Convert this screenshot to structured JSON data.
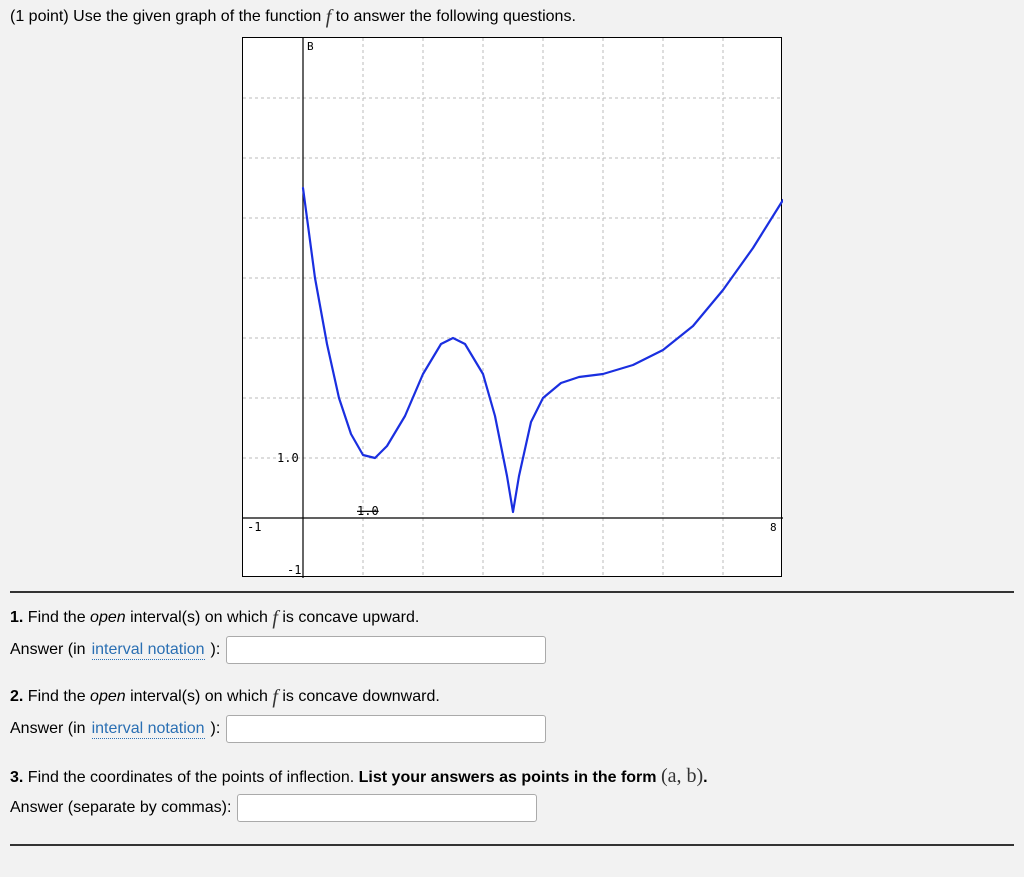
{
  "prompt": {
    "points_prefix": "(1 point) ",
    "text_before_f": "Use the given graph of the function ",
    "f": "f",
    "text_after_f": " to answer the following questions."
  },
  "graph": {
    "x_axis_min_label": "-1",
    "x_axis_max_label": "8",
    "y_axis_top_label": "B",
    "y_axis_bottom_label": "-1",
    "y_tick_label": "1.0",
    "x_tick_label": "1.0"
  },
  "q1": {
    "num": "1.",
    "before_em": " Find the ",
    "em": "open",
    "mid": " interval(s) on which ",
    "f": "f",
    "after": " is concave upward.",
    "answer_prefix": "Answer (in ",
    "link": "interval notation",
    "answer_suffix": "):"
  },
  "q2": {
    "num": "2.",
    "before_em": " Find the ",
    "em": "open",
    "mid": " interval(s) on which ",
    "f": "f",
    "after": " is concave downward.",
    "answer_prefix": "Answer (in ",
    "link": "interval notation",
    "answer_suffix": "):"
  },
  "q3": {
    "num": "3.",
    "text": " Find the coordinates of the points of inflection. ",
    "bold": "List your answers as points in the form ",
    "math": "(a, b)",
    "bold_end": ".",
    "answer_text": "Answer (separate by commas):"
  },
  "chart_data": {
    "type": "line",
    "xlabel": "",
    "ylabel": "",
    "xlim": [
      -1,
      8
    ],
    "ylim": [
      -1,
      8
    ],
    "y_gridlines": [
      1,
      2,
      3,
      4,
      5,
      6,
      7
    ],
    "x_gridlines": [
      1,
      2,
      3,
      4,
      5,
      6,
      7
    ],
    "series": [
      {
        "name": "f",
        "points": [
          [
            0.0,
            5.5
          ],
          [
            0.2,
            4.0
          ],
          [
            0.4,
            2.9
          ],
          [
            0.6,
            2.0
          ],
          [
            0.8,
            1.4
          ],
          [
            1.0,
            1.05
          ],
          [
            1.2,
            1.0
          ],
          [
            1.4,
            1.2
          ],
          [
            1.7,
            1.7
          ],
          [
            2.0,
            2.4
          ],
          [
            2.3,
            2.9
          ],
          [
            2.5,
            3.0
          ],
          [
            2.7,
            2.9
          ],
          [
            3.0,
            2.4
          ],
          [
            3.2,
            1.7
          ],
          [
            3.4,
            0.7
          ],
          [
            3.5,
            0.1
          ],
          [
            3.6,
            0.7
          ],
          [
            3.8,
            1.6
          ],
          [
            4.0,
            2.0
          ],
          [
            4.3,
            2.25
          ],
          [
            4.6,
            2.35
          ],
          [
            5.0,
            2.4
          ],
          [
            5.5,
            2.55
          ],
          [
            6.0,
            2.8
          ],
          [
            6.5,
            3.2
          ],
          [
            7.0,
            3.8
          ],
          [
            7.5,
            4.5
          ],
          [
            8.0,
            5.3
          ]
        ]
      }
    ]
  }
}
